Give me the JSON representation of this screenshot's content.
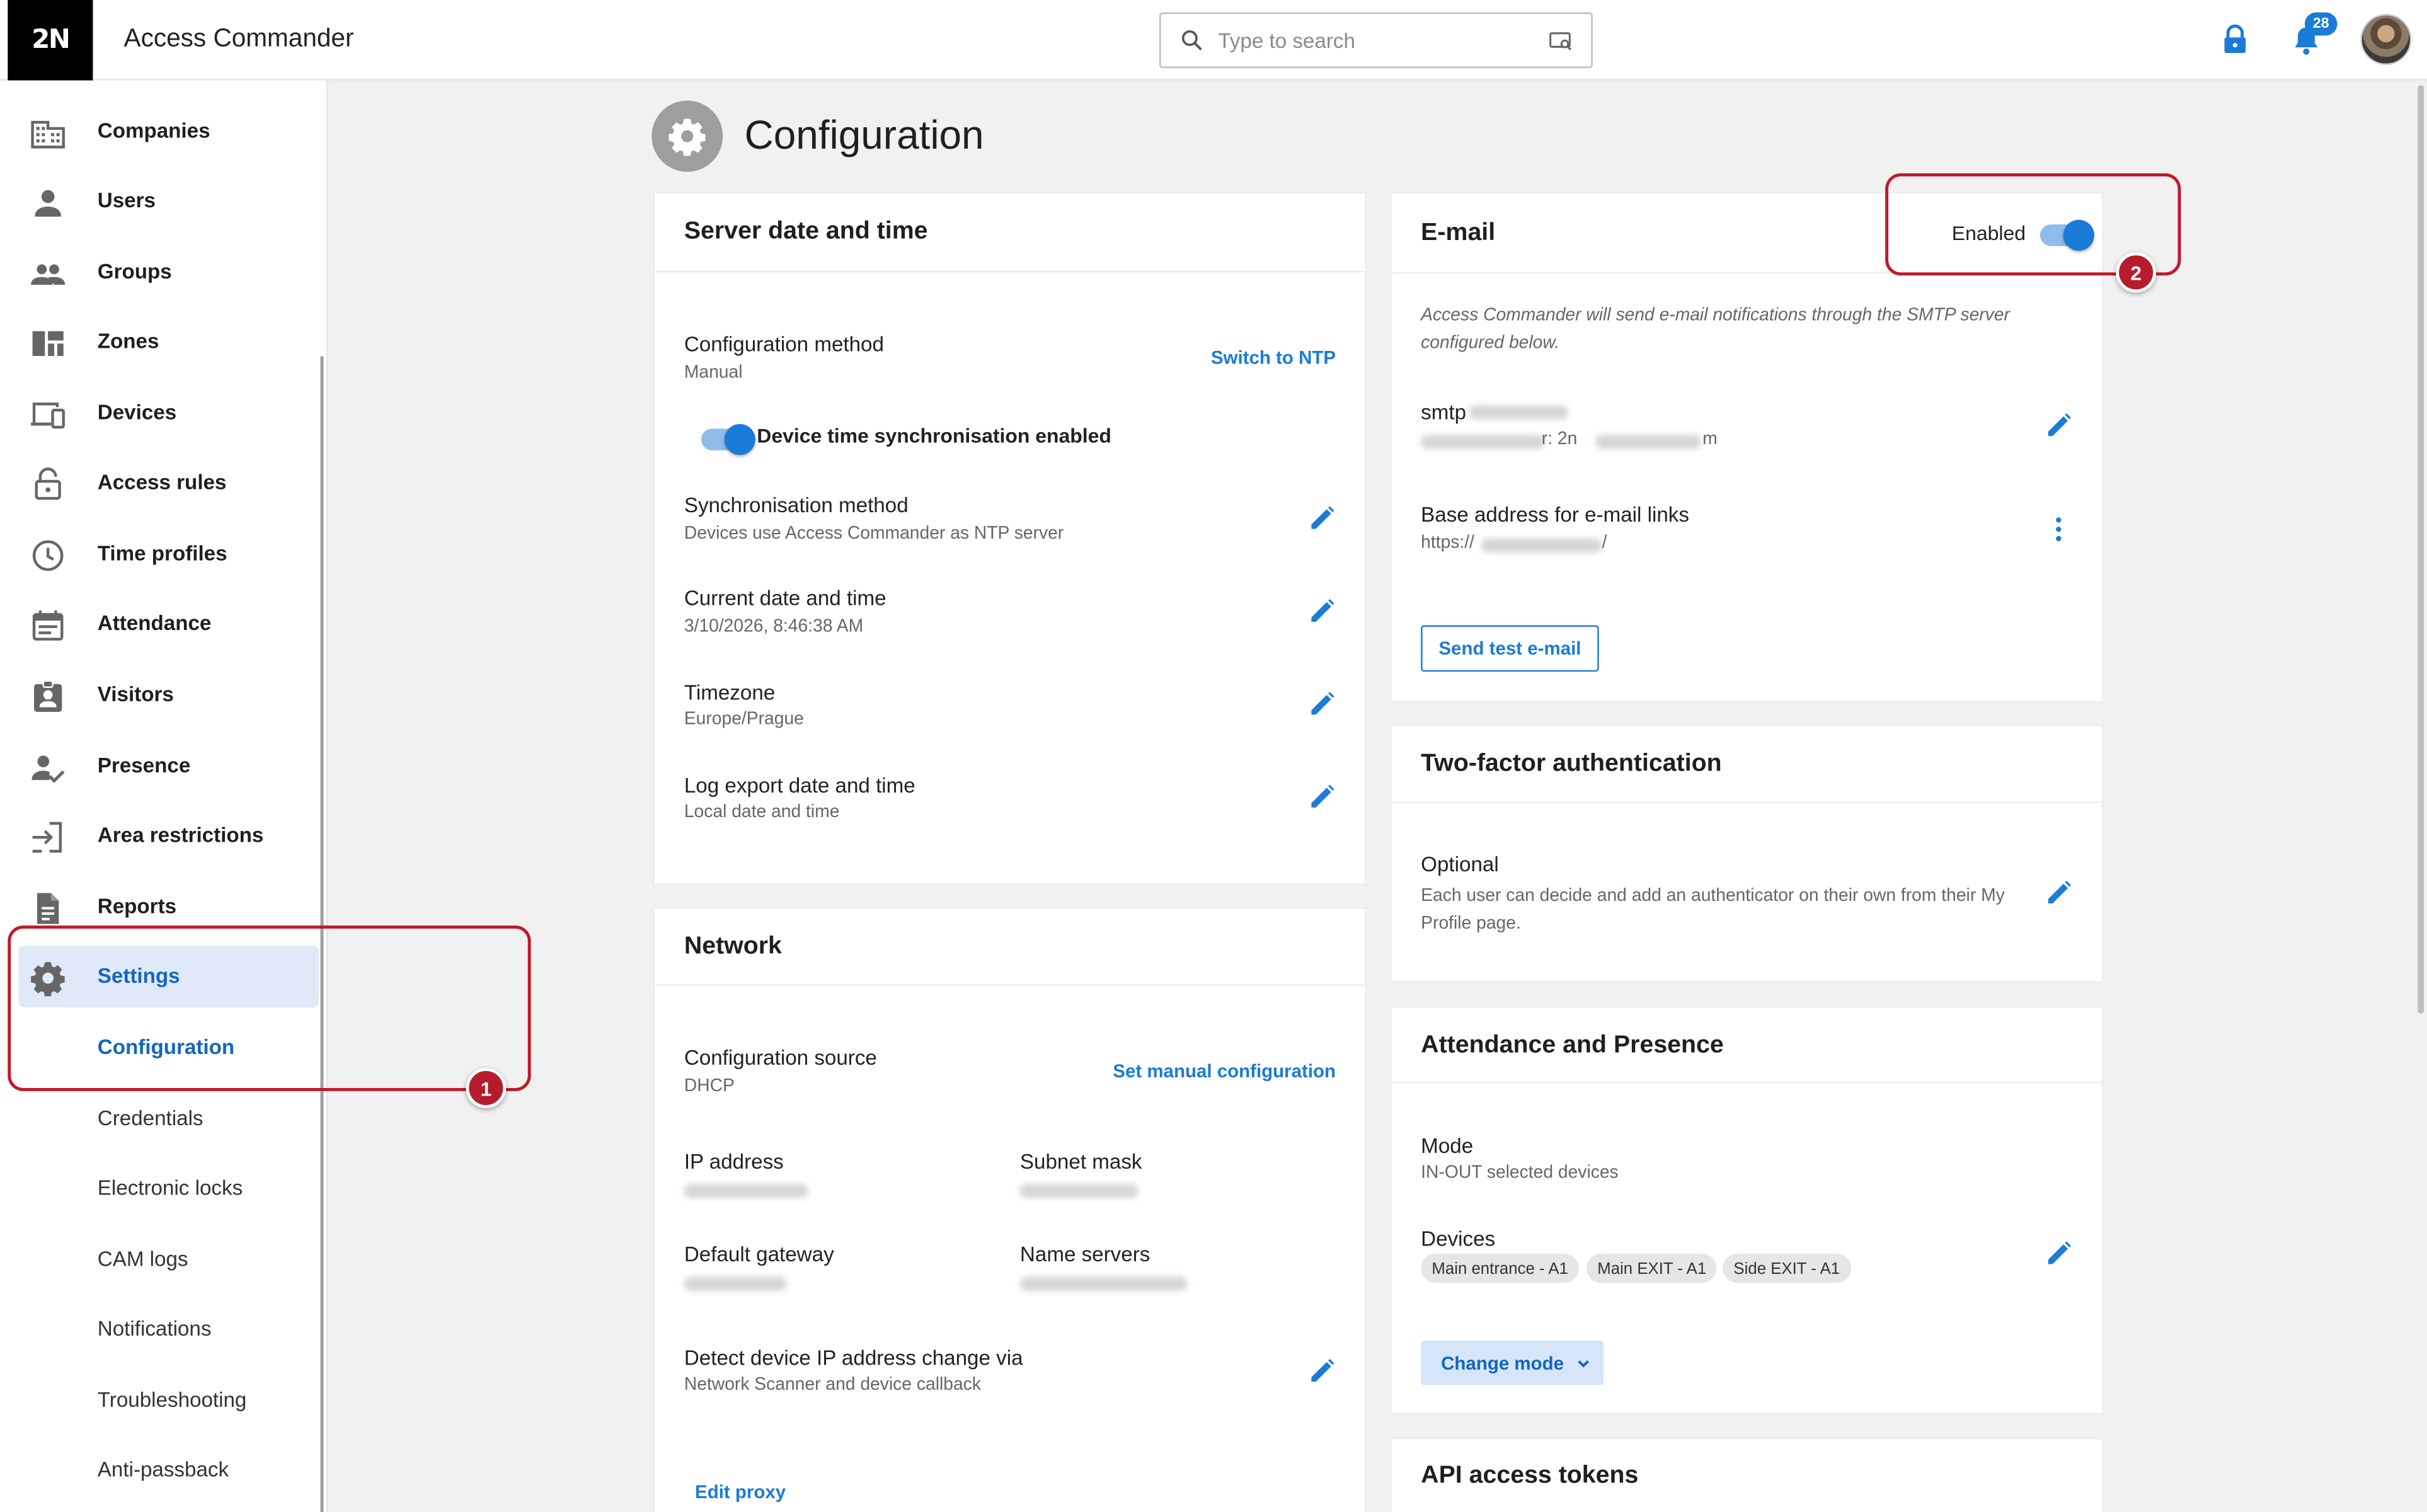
{
  "header": {
    "logo": "2N",
    "app_title": "Access Commander",
    "search_placeholder": "Type to search",
    "notification_count": "28"
  },
  "sidebar": {
    "items": [
      {
        "label": "Companies",
        "icon": "companies-icon"
      },
      {
        "label": "Users",
        "icon": "user-icon"
      },
      {
        "label": "Groups",
        "icon": "groups-icon"
      },
      {
        "label": "Zones",
        "icon": "zones-icon"
      },
      {
        "label": "Devices",
        "icon": "devices-icon"
      },
      {
        "label": "Access rules",
        "icon": "lock-icon"
      },
      {
        "label": "Time profiles",
        "icon": "clock-icon"
      },
      {
        "label": "Attendance",
        "icon": "calendar-icon"
      },
      {
        "label": "Visitors",
        "icon": "visitor-badge-icon"
      },
      {
        "label": "Presence",
        "icon": "presence-icon"
      },
      {
        "label": "Area restrictions",
        "icon": "area-restrictions-icon"
      },
      {
        "label": "Reports",
        "icon": "report-icon"
      },
      {
        "label": "Settings",
        "icon": "gear-icon"
      }
    ],
    "subitems": [
      "Configuration",
      "Credentials",
      "Electronic locks",
      "CAM logs",
      "Notifications",
      "Troubleshooting",
      "Anti-passback"
    ]
  },
  "page": {
    "title": "Configuration"
  },
  "server_time": {
    "title": "Server date and time",
    "config_method_label": "Configuration method",
    "config_method_value": "Manual",
    "switch_link": "Switch to NTP",
    "sync_toggle_label": "Device time synchronisation enabled",
    "sync_method_label": "Synchronisation method",
    "sync_method_value": "Devices use Access Commander as NTP server",
    "current_label": "Current date and time",
    "current_value": "3/10/2026, 8:46:38 AM",
    "timezone_label": "Timezone",
    "timezone_value": "Europe/Prague",
    "log_export_label": "Log export date and time",
    "log_export_value": "Local date and time"
  },
  "network": {
    "title": "Network",
    "config_source_label": "Configuration source",
    "config_source_value": "DHCP",
    "manual_link": "Set manual configuration",
    "ip_label": "IP address",
    "subnet_label": "Subnet mask",
    "gateway_label": "Default gateway",
    "dns_label": "Name servers",
    "detect_label": "Detect device IP address change via",
    "detect_value": "Network Scanner and device callback",
    "proxy_link": "Edit proxy"
  },
  "email": {
    "title": "E-mail",
    "enabled_label": "Enabled",
    "description": "Access Commander will send e-mail notifications through the SMTP server configured below.",
    "smtp_prefix": "smtp",
    "smtp_user_prefix": "r: 2n",
    "smtp_user_suffix": "m",
    "base_label": "Base address for e-mail links",
    "base_prefix": "https://",
    "base_suffix": "/",
    "test_button": "Send test e-mail"
  },
  "twofa": {
    "title": "Two-factor authentication",
    "mode_label": "Optional",
    "mode_desc": "Each user can decide and add an authenticator on their own from their My Profile page."
  },
  "attendance": {
    "title": "Attendance and Presence",
    "mode_label": "Mode",
    "mode_value": "IN-OUT selected devices",
    "devices_label": "Devices",
    "devices": [
      "Main entrance - A1",
      "Main EXIT - A1",
      "Side EXIT - A1"
    ],
    "change_mode": "Change mode"
  },
  "api": {
    "title": "API access tokens"
  },
  "callouts": {
    "one": "1",
    "two": "2"
  },
  "colors": {
    "accent": "#1a7bd8",
    "callout": "#c2182b",
    "active_bg": "#dfe9f7"
  }
}
